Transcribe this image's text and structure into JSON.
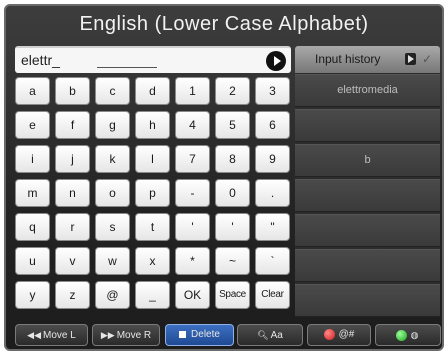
{
  "title": "English (Lower Case Alphabet)",
  "input": {
    "value": "elettr_"
  },
  "keys": [
    [
      "a",
      "b",
      "c",
      "d",
      "1",
      "2",
      "3"
    ],
    [
      "e",
      "f",
      "g",
      "h",
      "4",
      "5",
      "6"
    ],
    [
      "i",
      "j",
      "k",
      "l",
      "7",
      "8",
      "9"
    ],
    [
      "m",
      "n",
      "o",
      "p",
      "-",
      "0",
      "."
    ],
    [
      "q",
      "r",
      "s",
      "t",
      "'",
      "'",
      "\""
    ],
    [
      "u",
      "v",
      "w",
      "x",
      "*",
      "~",
      "`"
    ],
    [
      "y",
      "z",
      "@",
      "_",
      "OK",
      "Space",
      "Clear"
    ]
  ],
  "history": {
    "header_label": "Input history",
    "items": [
      "elettromedia",
      "",
      "b",
      "",
      "",
      "",
      ""
    ]
  },
  "function_bar": {
    "move_left": "Move L",
    "move_right": "Move R",
    "delete": "Delete",
    "case": "Aa",
    "symbols": "@#",
    "icons": {
      "move_left": "rewind-icon",
      "move_right": "fast-forward-icon",
      "delete": "blue-square-icon",
      "case": "magnify-icon",
      "symbols": "red-button-icon",
      "globe": "globe-icon"
    }
  },
  "colors": {
    "background": "#2a2a2a",
    "key_face": "#f2f2f2",
    "delete_blue": "#2b5db0",
    "red_button": "#d11a1a",
    "green_button": "#1aa51a"
  }
}
